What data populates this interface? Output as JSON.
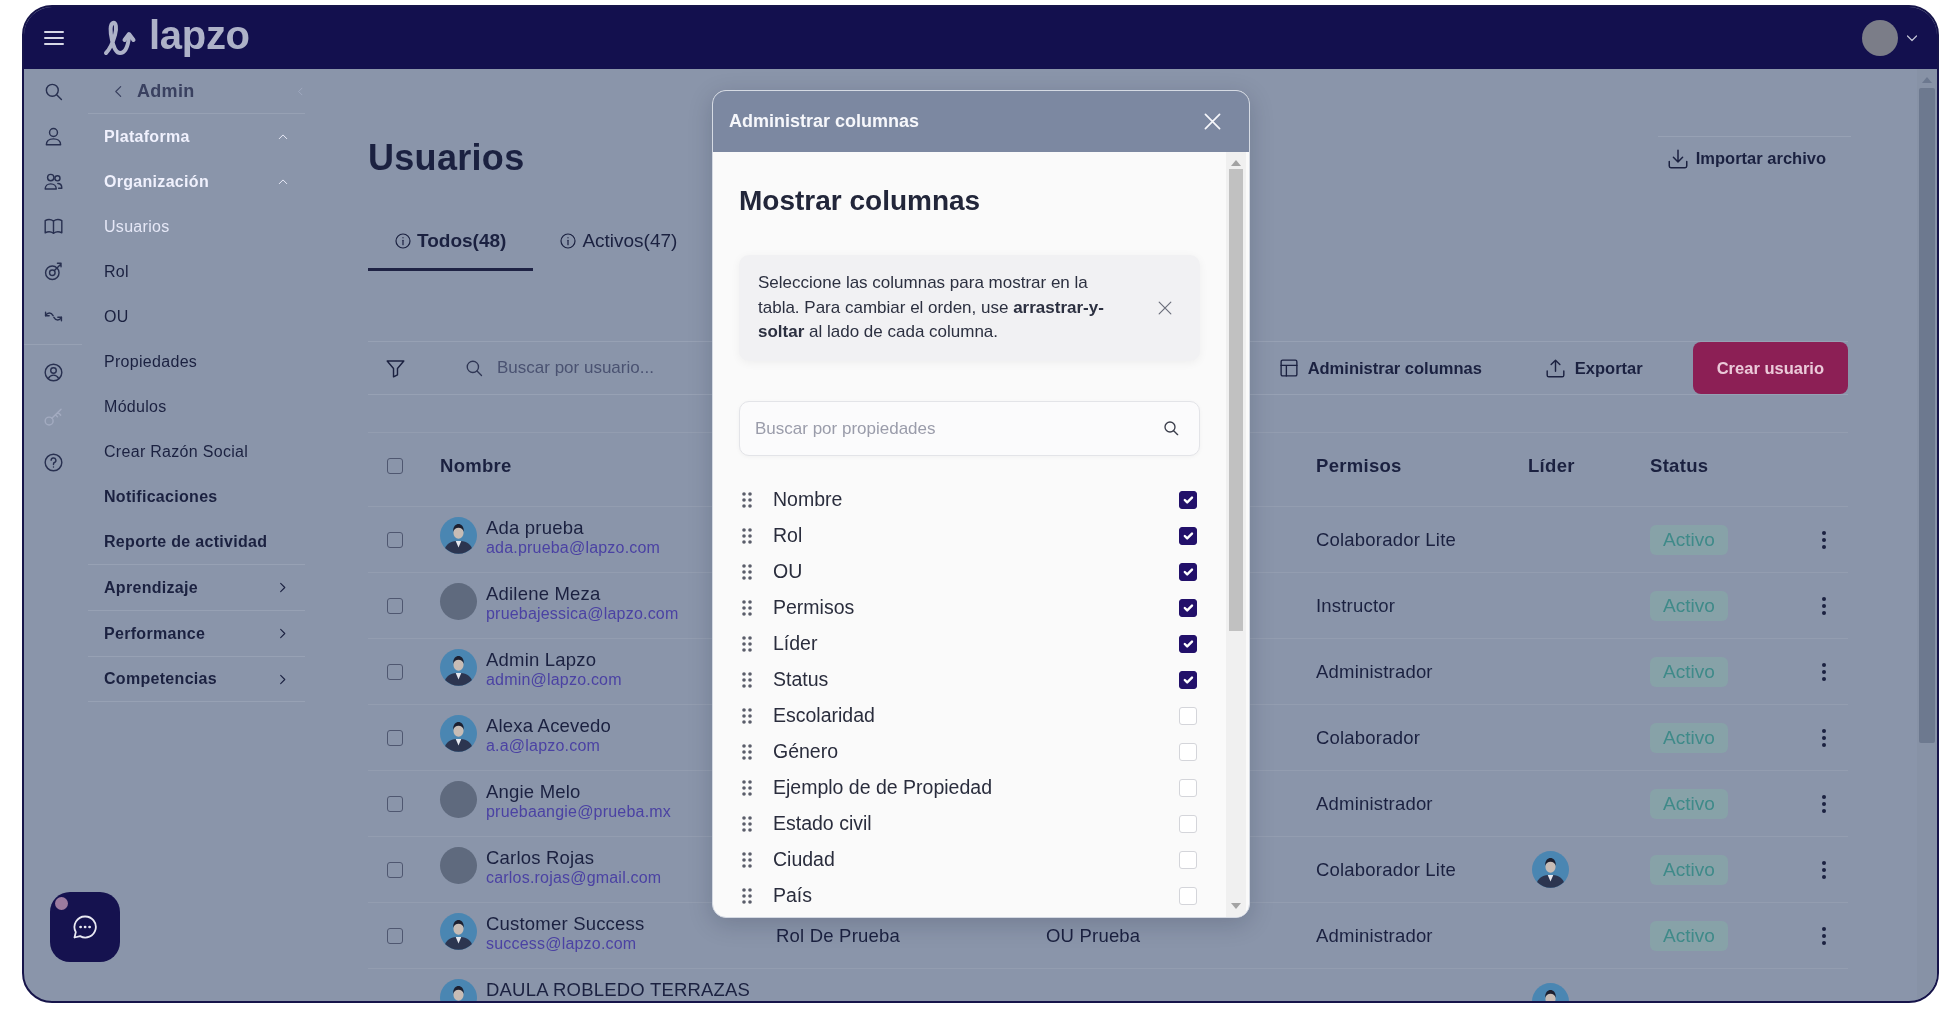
{
  "header": {
    "logo_text": "lapzo"
  },
  "sidebar": {
    "title": "Admin",
    "items": [
      {
        "kind": "group",
        "label": "Plataforma",
        "expanded": true
      },
      {
        "kind": "group",
        "label": "Organización",
        "expanded": true
      },
      {
        "kind": "page",
        "label": "Usuarios",
        "selected": true
      },
      {
        "kind": "page",
        "label": "Rol",
        "selected": false
      },
      {
        "kind": "page",
        "label": "OU",
        "selected": false
      },
      {
        "kind": "page",
        "label": "Propiedades",
        "selected": false
      },
      {
        "kind": "page",
        "label": "Módulos",
        "selected": false
      },
      {
        "kind": "page",
        "label": "Crear Razón Social",
        "selected": false
      },
      {
        "kind": "module",
        "label": "Notificaciones"
      },
      {
        "kind": "module",
        "label": "Reporte de actividad"
      },
      {
        "kind": "section",
        "label": "Aprendizaje",
        "expanded": false
      },
      {
        "kind": "section",
        "label": "Performance",
        "expanded": false
      },
      {
        "kind": "section",
        "label": "Competencias",
        "expanded": false
      }
    ]
  },
  "page": {
    "title": "Usuarios",
    "import_button": "Importar archivo"
  },
  "tabs": [
    {
      "label": "Todos(48)",
      "selected": true
    },
    {
      "label": "Activos(47)",
      "selected": false
    }
  ],
  "toolbar": {
    "search": {
      "placeholder": "Buscar por usuario..."
    },
    "buttons": [
      {
        "kind": "columns",
        "label": "Administrar columnas"
      },
      {
        "kind": "export",
        "label": "Exportar"
      },
      {
        "kind": "primary",
        "label": "Crear usuario"
      }
    ]
  },
  "table": {
    "select_all_checked": false,
    "columns": [
      {
        "kind": "name",
        "label": "Nombre"
      },
      {
        "kind": "permissions",
        "label": "Permisos"
      },
      {
        "kind": "leader",
        "label": "Líder"
      },
      {
        "kind": "status",
        "label": "Status"
      }
    ],
    "rows": [
      {
        "checked": false,
        "avatar": {
          "kind": "default"
        },
        "name": "Ada prueba",
        "email": "ada.prueba@lapzo.com",
        "permissions": "Colaborador Lite",
        "status": "Activo"
      },
      {
        "checked": false,
        "avatar": {
          "kind": "photo"
        },
        "name": "Adilene Meza",
        "email": "pruebajessica@lapzo.com",
        "permissions": "Instructor",
        "status": "Activo"
      },
      {
        "checked": false,
        "avatar": {
          "kind": "default"
        },
        "name": "Admin Lapzo",
        "email": "admin@lapzo.com",
        "permissions": "Administrador",
        "status": "Activo"
      },
      {
        "checked": false,
        "avatar": {
          "kind": "default"
        },
        "name": "Alexa Acevedo",
        "email": "a.a@lapzo.com",
        "permissions": "Colaborador",
        "status": "Activo"
      },
      {
        "checked": false,
        "avatar": {
          "kind": "photo"
        },
        "name": "Angie Melo",
        "email": "pruebaangie@prueba.mx",
        "permissions": "Administrador",
        "status": "Activo"
      },
      {
        "checked": false,
        "avatar": {
          "kind": "photo"
        },
        "name": "Carlos Rojas",
        "email": "carlos.rojas@gmail.com",
        "permissions": "Colaborador Lite",
        "leader_avatar": {
          "kind": "default"
        },
        "status": "Activo"
      },
      {
        "checked": false,
        "avatar": {
          "kind": "default"
        },
        "name": "Customer Success",
        "email": "success@lapzo.com",
        "role": "Rol De Prueba",
        "ou": "OU Prueba",
        "permissions": "Administrador",
        "status": "Activo"
      },
      {
        "avatar": {
          "kind": "default"
        },
        "name": "DAULA ROBLEDO TERRAZAS",
        "leader_avatar": {
          "kind": "default"
        }
      }
    ]
  },
  "modal": {
    "title": "Administrar columnas",
    "heading": "Mostrar columnas",
    "notice": "Seleccione las columnas para mostrar en la tabla. Para cambiar el orden, use **arrastrar-y-soltar** al lado de cada columna.",
    "search": {
      "placeholder": "Buscar por propiedades"
    },
    "columns": [
      {
        "label": "Nombre",
        "checked": true
      },
      {
        "label": "Rol",
        "checked": true
      },
      {
        "label": "OU",
        "checked": true
      },
      {
        "label": "Permisos",
        "checked": true
      },
      {
        "label": "Líder",
        "checked": true
      },
      {
        "label": "Status",
        "checked": true
      },
      {
        "label": "Escolaridad",
        "checked": false
      },
      {
        "label": "Género",
        "checked": false
      },
      {
        "label": "Ejemplo de de Propiedad",
        "checked": false
      },
      {
        "label": "Estado civil",
        "checked": false
      },
      {
        "label": "Ciudad",
        "checked": false
      },
      {
        "label": "País",
        "checked": false
      }
    ]
  }
}
